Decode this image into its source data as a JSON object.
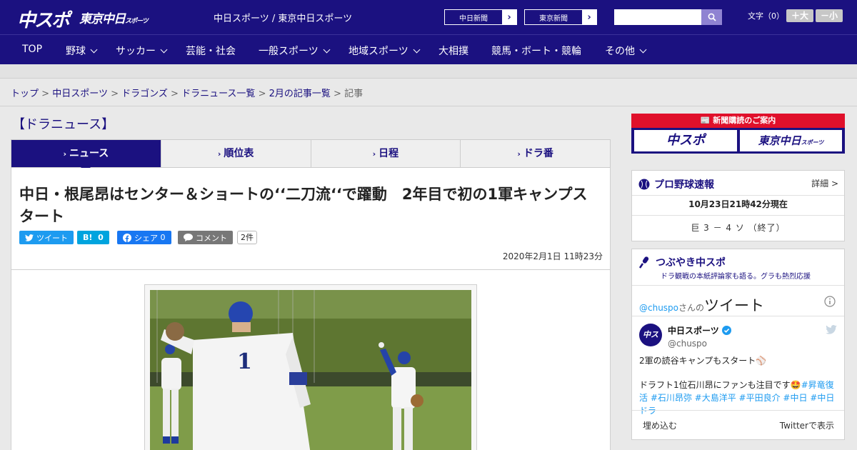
{
  "header": {
    "logo_chuspo": "中スポ",
    "logo_tokyo_main": "東京中日",
    "logo_tokyo_sub": "スポーツ",
    "site_title": "中日スポーツ / 東京中日スポーツ",
    "ext_links": [
      "中日新聞",
      "東京新聞"
    ],
    "search": {
      "placeholder": ""
    },
    "fontsize_label": "文字（0）",
    "fontsize_larger": "＋大",
    "fontsize_smaller": "－小"
  },
  "nav": {
    "items": [
      {
        "label": "TOP",
        "dropdown": false
      },
      {
        "label": "野球",
        "dropdown": true
      },
      {
        "label": "サッカー",
        "dropdown": true
      },
      {
        "label": "芸能・社会",
        "dropdown": false
      },
      {
        "label": "一般スポーツ",
        "dropdown": true
      },
      {
        "label": "地域スポーツ",
        "dropdown": true
      },
      {
        "label": "大相撲",
        "dropdown": false
      },
      {
        "label": "競馬・ボート・競輪",
        "dropdown": false
      },
      {
        "label": "その他",
        "dropdown": true
      }
    ]
  },
  "breadcrumb": {
    "links": [
      "トップ",
      "中日スポーツ",
      "ドラゴンズ",
      "ドラニュース一覧",
      "2月の記事一覧"
    ],
    "current": "記事",
    "separator": ">"
  },
  "section": {
    "title": "【ドラニュース】"
  },
  "tabs": [
    {
      "label": "ニュース",
      "active": true
    },
    {
      "label": "順位表",
      "active": false
    },
    {
      "label": "日程",
      "active": false
    },
    {
      "label": "ドラ番",
      "active": false
    }
  ],
  "article": {
    "headline": "中日・根尾昂はセンター＆ショートの‘‘二刀流‘‘で躍動　2年目で初の1軍キャンプスタート",
    "share": {
      "tweet": "ツイート",
      "hatena_label": "B!",
      "hatena_count": "0",
      "facebook": "シェア",
      "facebook_count": "0",
      "comment": "コメント",
      "comment_count": "2件"
    },
    "published": "2020年2月1日 11時23分"
  },
  "sidebar": {
    "subscription": {
      "title": "新聞購読のご案内",
      "buttons": [
        "中スポ",
        "東京中日"
      ],
      "button_sub": "スポーツ"
    },
    "scores": {
      "title": "プロ野球速報",
      "detail": "詳細 >",
      "as_of": "10月23日21時42分現在",
      "game": "巨 3 － 4 ソ （終了）"
    },
    "tweets": {
      "title": "つぶやき中スポ",
      "subtitle": "ドラ観戦の本紙評論家も語る。グラも熱烈応援",
      "handle": "@chuspo",
      "handle_suffix": "さんの",
      "heading": "ツイート",
      "tweet": {
        "avatar_text": "中スポ",
        "name": "中日スポーツ",
        "at": "@chuspo",
        "line1": "2軍の読谷キャンプもスタート⚾",
        "line2": "ドラフト1位石川昂にファンも注目です🤩",
        "tags": "#昇竜復活 #石川昂弥 #大島洋平 #平田良介 #中日 #中日ドラ"
      },
      "embed": "埋め込む",
      "view_on_twitter": "Twitterで表示"
    }
  },
  "colors": {
    "brand_navy": "#1b1180",
    "accent_red": "#e0102b",
    "twitter_blue": "#1d9bf0",
    "hatena_blue": "#00a4de",
    "facebook_blue": "#1877f2",
    "comment_grey": "#777777"
  },
  "icons": {
    "search": "search-icon",
    "twitter": "twitter-bird-icon",
    "facebook": "facebook-icon",
    "comment": "speech-bubble-icon",
    "baseball": "baseball-icon",
    "microphone": "microphone-icon",
    "info": "info-icon",
    "verified": "verified-badge-icon"
  }
}
